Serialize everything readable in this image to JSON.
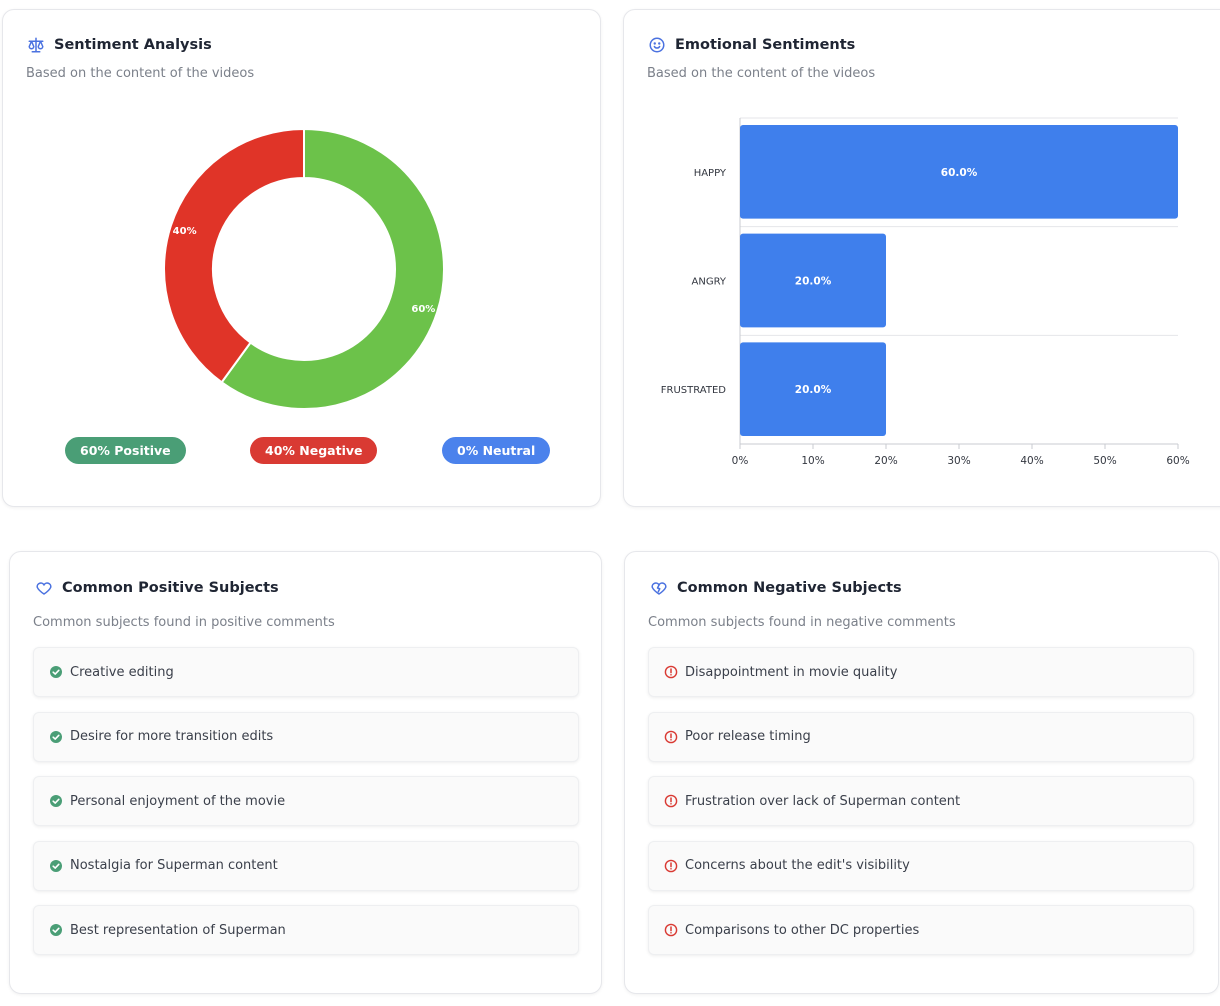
{
  "sentiment": {
    "title": "Sentiment Analysis",
    "subtitle": "Based on the content of the videos",
    "icon": "scale-icon",
    "slices": [
      {
        "label": "60%",
        "value": 60,
        "color": "#6cc24a"
      },
      {
        "label": "40%",
        "value": 40,
        "color": "#e03428"
      }
    ],
    "pills": {
      "positive": "60% Positive",
      "negative": "40% Negative",
      "neutral": "0% Neutral"
    },
    "colors": {
      "positive_pill": "#4a9e76",
      "negative_pill": "#d93a33",
      "neutral_pill": "#4b82ec"
    }
  },
  "emotional": {
    "title": "Emotional Sentiments",
    "subtitle": "Based on the content of the videos",
    "icon": "smiley-icon"
  },
  "chart_data": [
    {
      "type": "pie",
      "categories": [
        "Positive",
        "Negative"
      ],
      "values": [
        60,
        40
      ],
      "labels": [
        "60%",
        "40%"
      ],
      "colors": [
        "#6cc24a",
        "#e03428"
      ]
    },
    {
      "type": "bar",
      "orientation": "horizontal",
      "categories": [
        "HAPPY",
        "ANGRY",
        "FRUSTRATED"
      ],
      "values": [
        60.0,
        20.0,
        20.0
      ],
      "value_labels": [
        "60.0%",
        "20.0%",
        "20.0%"
      ],
      "xlim": [
        0,
        60
      ],
      "xticks": [
        "0%",
        "10%",
        "20%",
        "30%",
        "40%",
        "50%",
        "60%"
      ],
      "color": "#3f7fec",
      "grid": true
    }
  ],
  "positive": {
    "title": "Common Positive Subjects",
    "subtitle": "Common subjects found in positive comments",
    "icon": "heart-outline-icon",
    "items": [
      "Creative editing",
      "Desire for more transition edits",
      "Personal enjoyment of the movie",
      "Nostalgia for Superman content",
      "Best representation of Superman"
    ]
  },
  "negative": {
    "title": "Common Negative Subjects",
    "subtitle": "Common subjects found in negative comments",
    "icon": "broken-heart-icon",
    "items": [
      "Disappointment in movie quality",
      "Poor release timing",
      "Frustration over lack of Superman content",
      "Concerns about the edit's visibility",
      "Comparisons to other DC properties"
    ]
  }
}
